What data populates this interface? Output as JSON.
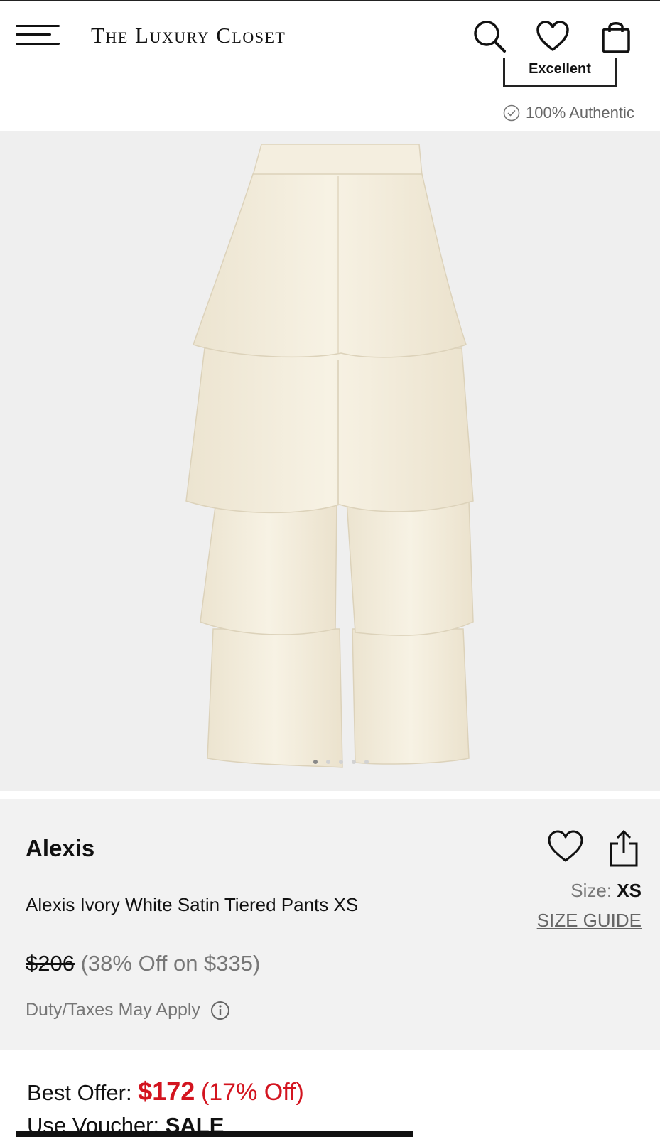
{
  "header": {
    "logo": "The Luxury Closet",
    "icons": [
      "menu-icon",
      "search-icon",
      "heart-icon",
      "shopping-bag-icon"
    ]
  },
  "condition": {
    "label": "Excellent"
  },
  "authentic": {
    "label": "100% Authentic"
  },
  "gallery": {
    "image": "ivory-satin-tiered-pants",
    "dot_count": 5,
    "active_dot": 1
  },
  "product": {
    "brand": "Alexis",
    "name": "Alexis Ivory White Satin Tiered Pants XS",
    "size_label": "Size:",
    "size_value": "XS",
    "size_guide": "SIZE GUIDE",
    "price": "$206",
    "discount": "(38% Off on $335)",
    "duty": "Duty/Taxes May Apply"
  },
  "offer": {
    "label": "Best Offer:",
    "amount": "$172",
    "percent": "(17% Off)",
    "voucher_label": "Use Voucher:",
    "voucher_code": "SALE"
  },
  "colors": {
    "accent_red": "#d3141f",
    "panel_bg": "#f2f2f2",
    "image_bg": "#efefef"
  }
}
